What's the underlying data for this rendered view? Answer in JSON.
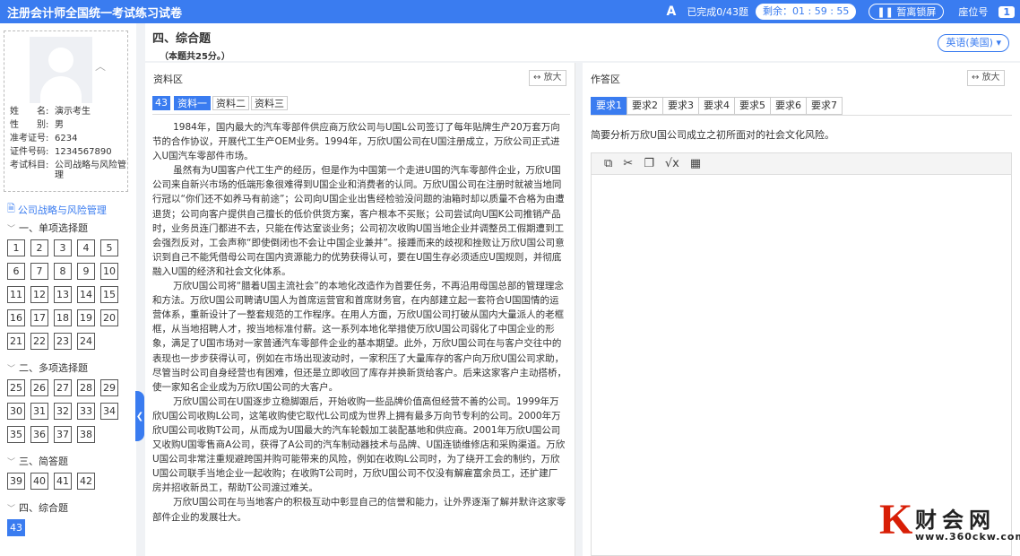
{
  "header": {
    "title": "注册会计师全国统一考试练习试卷",
    "font_icon": "A",
    "progress": "已完成0/43题",
    "timer_label": "剩余：",
    "timer": "01 : 59 : 55",
    "lock_label": "暂离锁屏",
    "seat_label": "座位号",
    "seat_no": "1"
  },
  "profile": {
    "rows": [
      {
        "k": "姓　　名:",
        "v": "演示考生"
      },
      {
        "k": "性　　别:",
        "v": "男"
      },
      {
        "k": "准考证号:",
        "v": "6234"
      },
      {
        "k": "证件号码:",
        "v": "1234567890"
      },
      {
        "k": "考试科目:",
        "v": "公司战略与风险管理"
      }
    ]
  },
  "nav": {
    "subject": "公司战略与风险管理",
    "sections": [
      {
        "title": "一、单项选择题",
        "items": [
          "1",
          "2",
          "3",
          "4",
          "5",
          "6",
          "7",
          "8",
          "9",
          "10",
          "11",
          "12",
          "13",
          "14",
          "15",
          "16",
          "17",
          "18",
          "19",
          "20",
          "21",
          "22",
          "23",
          "24"
        ]
      },
      {
        "title": "二、多项选择题",
        "items": [
          "25",
          "26",
          "27",
          "28",
          "29",
          "30",
          "31",
          "32",
          "33",
          "34",
          "35",
          "36",
          "37",
          "38"
        ]
      },
      {
        "title": "三、简答题",
        "items": [
          "39",
          "40",
          "41",
          "42"
        ]
      },
      {
        "title": "四、综合题",
        "items": [
          "43"
        ]
      }
    ],
    "active": "43"
  },
  "main": {
    "section_title": "四、综合题",
    "section_note": "（本题共25分。）",
    "language": "英语(美国)"
  },
  "material": {
    "panel_title": "资料区",
    "expand": "放大",
    "q_no": "43",
    "tabs": [
      "资料一",
      "资料二",
      "资料三"
    ],
    "paragraphs": [
      "1984年，国内最大的汽车零部件供应商万欣公司与U国L公司签订了每年贴牌生产20万套万向节的合作协议，开展代工生产OEM业务。1994年，万欣U国公司在U国注册成立，万欣公司正式进入U国汽车零部件市场。",
      "虽然有为U国客户代工生产的经历，但是作为中国第一个走进U国的汽车零部件企业，万欣U国公司来自新兴市场的低端形象很难得到U国企业和消费者的认同。万欣U国公司在注册时就被当地同行冠以“你们还不如养马有前途”；公司向U国企业出售经检验没问题的油箱时却以质量不合格为由遭退货；公司向客户提供自己擅长的低价供货方案，客户根本不买账；公司尝试向U国K公司推销产品时，业务员连门都进不去，只能在传达室谈业务；公司初次收购U国当地企业并调整员工假期遭到工会强烈反对，工会声称“即使倒闭也不会让中国企业兼并”。接踵而来的歧视和挫败让万欣U国公司意识到自己不能凭借母公司在国内资源能力的优势获得认可，要在U国生存必须适应U国规则，并彻底融入U国的经济和社会文化体系。",
      "万欣U国公司将“腊着U国主流社会”的本地化改造作为首要任务，不再沿用母国总部的管理理念和方法。万欣U国公司聘请U国人为首席运营官和首席财务官，在内部建立起一套符合U国国情的运营体系，重新设计了一整套规范的工作程序。在用人方面，万欣U国公司打破从国内大量派人的老框框，从当地招聘人才，按当地标准付薪。这一系列本地化举措使万欣U国公司弱化了中国企业的形象，满足了U国市场对一家普通汽车零部件企业的基本期望。此外，万欣U国公司在与客户交往中的表现也一步步获得认可，例如在市场出现波动时，一家积压了大量库存的客户向万欣U国公司求助，尽管当时公司自身经营也有困难，但还是立即收回了库存并换新货给客户。后来这家客户主动搭桥，使一家知名企业成为万欣U国公司的大客户。",
      "万欣U国公司在U国逐步立稳脚跟后，开始收购一些品牌价值高但经营不善的公司。1999年万欣U国公司收购L公司，这笔收购使它取代L公司成为世界上拥有最多万向节专利的公司。2000年万欣U国公司收购T公司，从而成为U国最大的汽车轮毂加工装配基地和供应商。2001年万欣U国公司又收购U国零售商A公司，获得了A公司的汽车制动器技术与品牌、U国连锁维修店和采购渠道。万欣U国公司非常注重规避跨国并购可能带来的风险，例如在收购L公司时，为了绕开工会的制约，万欣U国公司联手当地企业一起收购；在收购T公司时，万欣U国公司不仅没有解雇富余员工，还扩建厂房并招收新员工，帮助T公司渡过难关。",
      "万欣U国公司在与当地客户的积极互动中彰显自己的信誉和能力，让外界逐渐了解并默许这家零部件企业的发展壮大。"
    ]
  },
  "answer": {
    "panel_title": "作答区",
    "expand": "放大",
    "tabs": [
      "要求1",
      "要求2",
      "要求3",
      "要求4",
      "要求5",
      "要求6",
      "要求7"
    ],
    "question": "简要分析万欣U国公司成立之初所面对的社会文化风险。",
    "toolbar_icons": [
      "paste-icon",
      "cut-icon",
      "copy-icon",
      "formula-icon",
      "table-icon"
    ]
  },
  "watermark": {
    "k": "K",
    "name": "财会网",
    "url": "www.360ckw.com"
  }
}
